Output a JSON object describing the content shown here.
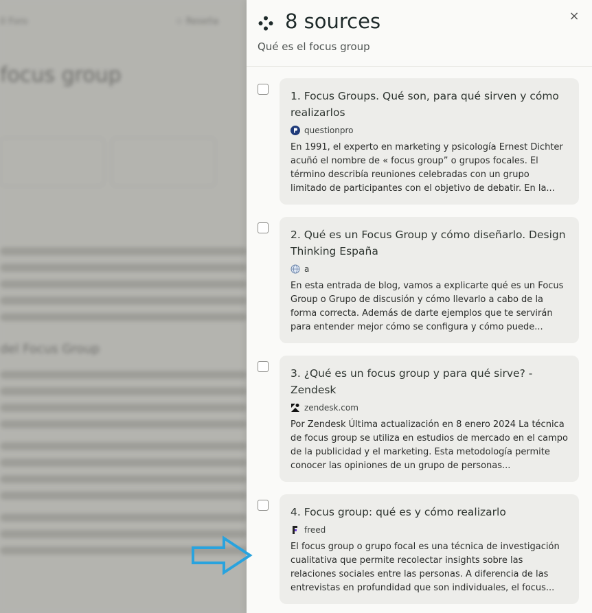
{
  "panel": {
    "title": "8 sources",
    "subtitle": "Qué es el focus group",
    "close_label": "×"
  },
  "background_page": {
    "title": "focus group",
    "nav_left": "0 Foro",
    "nav_right": "☆ Reseña",
    "section_heading": "del Focus Group"
  },
  "sources": [
    {
      "title": "1. Focus Groups. Qué son, para qué sirven y cómo realizarlos",
      "domain": "questionpro",
      "favicon": "questionpro-icon",
      "snippet": "En 1991, el experto en marketing y psicología Ernest Dichter acuñó el nombre de « focus group” o grupos focales. El término describía reuniones celebradas con un grupo limitado de participantes con el objetivo de debatir. En la..."
    },
    {
      "title": "2. Qué es un Focus Group y cómo diseñarlo. Design Thinking España",
      "domain": "a",
      "favicon": "globe-icon",
      "snippet": "En esta entrada de blog, vamos a explicarte qué es un Focus Group o Grupo de discusión y cómo llevarlo a cabo de la forma correcta. Además de darte ejemplos que te servirán para entender mejor cómo se configura y cómo puede..."
    },
    {
      "title": "3. ¿Qué es un focus group y para qué sirve? - Zendesk",
      "domain": "zendesk.com",
      "favicon": "zendesk-icon",
      "snippet": "Por Zendesk Última actualización en 8 enero 2024 La técnica de focus group se utiliza en estudios de mercado en el campo de la publicidad y el marketing. Esta metodología permite conocer las opiniones de un grupo de personas..."
    },
    {
      "title": "4. Focus group: qué es y cómo realizarlo",
      "domain": "freed",
      "favicon": "freed-icon",
      "snippet": "El focus group o grupo focal es una técnica de investigación cualitativa que permite recolectar insights sobre las relaciones sociales entre las personas. A diferencia de las entrevistas en profundidad que son individuales, el focus..."
    }
  ],
  "colors": {
    "panel_bg": "#fafaf8",
    "card_bg": "#ededea",
    "arrow": "#29a3de",
    "questionpro": "#1f3b7a"
  }
}
